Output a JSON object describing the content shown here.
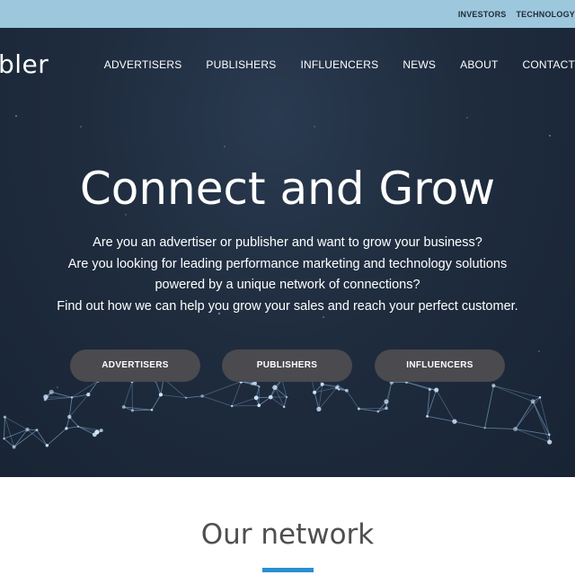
{
  "topbar": {
    "links": [
      "INVESTORS",
      "TECHNOLOGY"
    ]
  },
  "header": {
    "logo_text": "bler",
    "nav": [
      "ADVERTISERS",
      "PUBLISHERS",
      "INFLUENCERS",
      "NEWS",
      "ABOUT",
      "CONTACT"
    ]
  },
  "hero": {
    "headline": "Connect and Grow",
    "lines": [
      "Are you an advertiser or publisher and want to grow your business?",
      "Are you looking for leading performance marketing and technology solutions",
      "powered by a unique network of connections?",
      "Find out how we can help you grow your sales and reach your perfect customer."
    ],
    "buttons": [
      "ADVERTISERS",
      "PUBLISHERS",
      "INFLUENCERS"
    ]
  },
  "network_section": {
    "title": "Our network"
  },
  "colors": {
    "topbar": "#9dc7dc",
    "hero_bg": "#1f2c3e",
    "button_bg": "#4a4a4f",
    "accent": "#2b8fd0"
  }
}
